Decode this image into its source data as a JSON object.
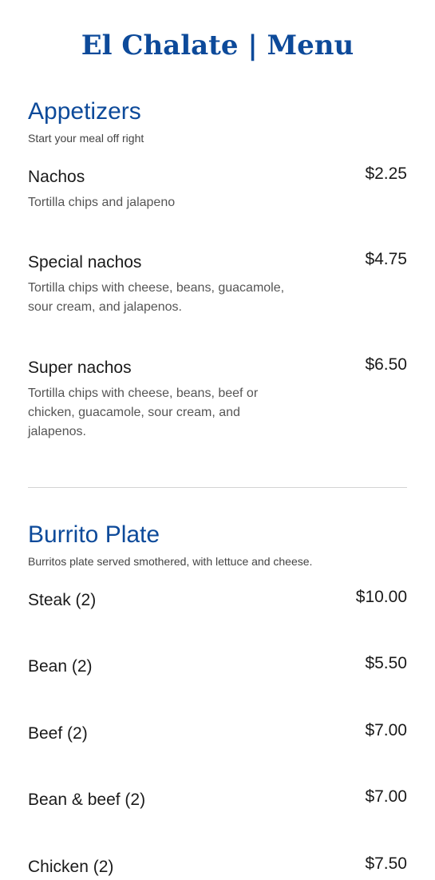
{
  "page": {
    "title": "El Chalate | Menu"
  },
  "sections": [
    {
      "title": "Appetizers",
      "subtitle": "Start your meal off right",
      "items": [
        {
          "name": "Nachos",
          "price": "$2.25",
          "description": "Tortilla chips and jalapeno"
        },
        {
          "name": "Special nachos",
          "price": "$4.75",
          "description": "Tortilla chips with cheese, beans, guacamole, sour cream, and jalapenos."
        },
        {
          "name": "Super nachos",
          "price": "$6.50",
          "description": "Tortilla chips with cheese, beans, beef or chicken, guacamole, sour cream, and jalapenos."
        }
      ]
    },
    {
      "title": "Burrito Plate",
      "subtitle": "Burritos plate served smothered, with lettuce and cheese.",
      "items": [
        {
          "name": "Steak (2)",
          "price": "$10.00"
        },
        {
          "name": "Bean (2)",
          "price": "$5.50"
        },
        {
          "name": "Beef (2)",
          "price": "$7.00"
        },
        {
          "name": "Bean & beef (2)",
          "price": "$7.00"
        },
        {
          "name": "Chicken (2)",
          "price": "$7.50"
        }
      ]
    }
  ]
}
